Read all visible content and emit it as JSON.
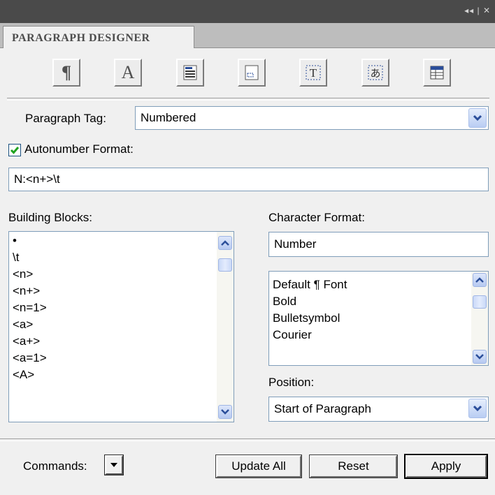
{
  "window": {
    "controls": "◂◂ | ✕"
  },
  "tab": {
    "label": "PARAGRAPH DESIGNER"
  },
  "toolbar": {
    "icons": [
      "paragraph-icon",
      "font-icon",
      "pagination-icon",
      "numbering-icon",
      "advanced-icon",
      "asian-icon",
      "table-cell-icon"
    ],
    "pilcrow": "¶",
    "letter_a": "A",
    "asian_char": "あ"
  },
  "paragraph_tag": {
    "label": "Paragraph Tag:",
    "value": "Numbered"
  },
  "autonumber": {
    "label": "Autonumber Format:",
    "checked": true,
    "value": "N:<n+>\\t"
  },
  "building_blocks": {
    "label": "Building Blocks:",
    "items": [
      "•",
      "\\t",
      "<n>",
      "<n+>",
      "<n=1>",
      "<a>",
      "<a+>",
      "<a=1>",
      "<A>"
    ]
  },
  "character_format": {
    "label": "Character Format:",
    "value": "Number",
    "items": [
      "Default ¶ Font",
      "Bold",
      "Bulletsymbol",
      "Courier"
    ]
  },
  "position": {
    "label": "Position:",
    "value": "Start of Paragraph"
  },
  "commands": {
    "label": "Commands:"
  },
  "buttons": {
    "update_all": "Update All",
    "reset": "Reset",
    "apply": "Apply"
  },
  "colors": {
    "accent_blue": "#2b4e9a",
    "checkbox_check": "#1fa31f",
    "field_border": "#7f9db9"
  }
}
